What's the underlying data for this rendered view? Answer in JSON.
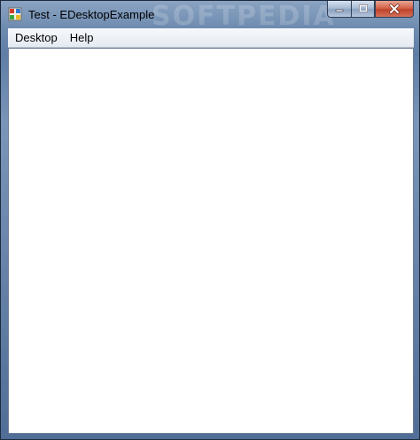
{
  "window": {
    "title": "Test - EDesktopExample",
    "watermark": "SOFTPEDIA"
  },
  "caption_buttons": {
    "minimize_icon": "minimize-icon",
    "maximize_icon": "maximize-icon",
    "close_icon": "close-icon"
  },
  "menubar": {
    "items": [
      {
        "label": "Desktop"
      },
      {
        "label": "Help"
      }
    ]
  },
  "colors": {
    "close_button": "#c0432a",
    "client_background": "#ffffff"
  }
}
